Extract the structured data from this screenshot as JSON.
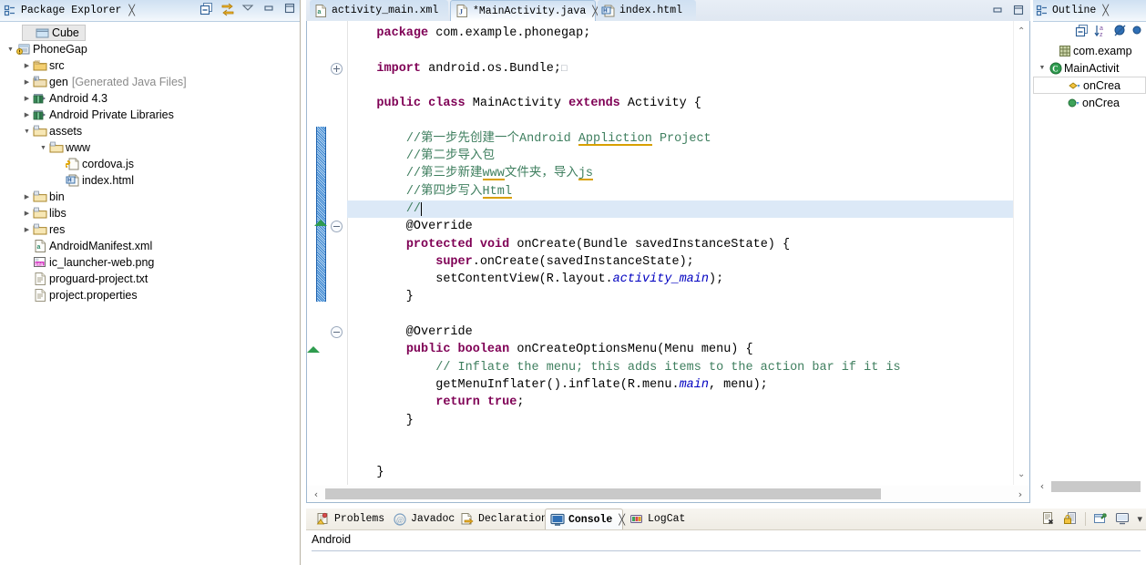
{
  "package_explorer": {
    "title": "Package Explorer",
    "close_glyph": "╳",
    "toolbar": [
      {
        "name": "collapse-all-icon",
        "title": "Collapse All"
      },
      {
        "name": "link-with-editor-icon",
        "title": "Link with Editor"
      },
      {
        "name": "view-menu-icon",
        "title": "View Menu"
      },
      {
        "name": "minimize-icon",
        "title": "Minimize"
      },
      {
        "name": "maximize-icon",
        "title": "Maximize"
      }
    ],
    "tree": [
      {
        "label": "Cube",
        "icon": "project-closed-icon",
        "twisty": "",
        "indent": 1,
        "selected": true,
        "note": ""
      },
      {
        "label": "PhoneGap",
        "icon": "android-project-icon",
        "twisty": "▼",
        "indent": 0,
        "selected": false,
        "note": ""
      },
      {
        "label": "src",
        "icon": "source-folder-icon",
        "twisty": "▶",
        "indent": 1,
        "selected": false,
        "note": ""
      },
      {
        "label": "gen",
        "icon": "gen-folder-icon",
        "twisty": "▶",
        "indent": 1,
        "selected": false,
        "note": "[Generated Java Files]"
      },
      {
        "label": "Android 4.3",
        "icon": "library-icon",
        "twisty": "▶",
        "indent": 1,
        "selected": false,
        "note": ""
      },
      {
        "label": "Android Private Libraries",
        "icon": "library-icon",
        "twisty": "▶",
        "indent": 1,
        "selected": false,
        "note": ""
      },
      {
        "label": "assets",
        "icon": "folder-icon",
        "twisty": "▼",
        "indent": 1,
        "selected": false,
        "note": ""
      },
      {
        "label": "www",
        "icon": "folder-icon",
        "twisty": "▼",
        "indent": 2,
        "selected": false,
        "note": ""
      },
      {
        "label": "cordova.js",
        "icon": "js-file-icon",
        "twisty": "",
        "indent": 3,
        "selected": false,
        "note": ""
      },
      {
        "label": "index.html",
        "icon": "html-file-icon",
        "twisty": "",
        "indent": 3,
        "selected": false,
        "note": ""
      },
      {
        "label": "bin",
        "icon": "folder-icon",
        "twisty": "▶",
        "indent": 1,
        "selected": false,
        "note": ""
      },
      {
        "label": "libs",
        "icon": "folder-icon",
        "twisty": "▶",
        "indent": 1,
        "selected": false,
        "note": ""
      },
      {
        "label": "res",
        "icon": "folder-icon",
        "twisty": "▶",
        "indent": 1,
        "selected": false,
        "note": ""
      },
      {
        "label": "AndroidManifest.xml",
        "icon": "xml-file-icon",
        "twisty": "",
        "indent": 1,
        "selected": false,
        "note": ""
      },
      {
        "label": "ic_launcher-web.png",
        "icon": "png-file-icon",
        "twisty": "",
        "indent": 1,
        "selected": false,
        "note": ""
      },
      {
        "label": "proguard-project.txt",
        "icon": "text-file-icon",
        "twisty": "",
        "indent": 1,
        "selected": false,
        "note": ""
      },
      {
        "label": "project.properties",
        "icon": "text-file-icon",
        "twisty": "",
        "indent": 1,
        "selected": false,
        "note": ""
      }
    ]
  },
  "editor": {
    "tabs": [
      {
        "label": "activity_main.xml",
        "icon": "xml-file-icon",
        "active": false,
        "dirty": false,
        "closeable": false
      },
      {
        "label": "*MainActivity.java",
        "icon": "java-file-icon",
        "active": true,
        "dirty": true,
        "closeable": true
      },
      {
        "label": "index.html",
        "icon": "html-file-icon",
        "active": false,
        "dirty": false,
        "closeable": false
      }
    ],
    "close_glyph": "╳",
    "window_buttons": [
      {
        "name": "minimize-icon",
        "title": "Minimize"
      },
      {
        "name": "maximize-icon",
        "title": "Maximize"
      }
    ],
    "scroll": {
      "left_arrow": "‹",
      "right_arrow": "›",
      "up_caret": "⌃",
      "down_caret": "⌄"
    },
    "code_lines": [
      {
        "indent": 1,
        "tokens": [
          {
            "t": "package",
            "c": "kw"
          },
          {
            "t": " com.example.phonegap;",
            "c": ""
          }
        ]
      },
      {
        "indent": 0,
        "tokens": []
      },
      {
        "indent": 1,
        "fold": "plus",
        "tokens": [
          {
            "t": "import",
            "c": "kw"
          },
          {
            "t": " android.os.Bundle;",
            "c": ""
          },
          {
            "t": "□",
            "c": "box"
          }
        ]
      },
      {
        "indent": 0,
        "tokens": []
      },
      {
        "indent": 1,
        "tokens": [
          {
            "t": "public",
            "c": "kw"
          },
          {
            "t": " ",
            "c": ""
          },
          {
            "t": "class",
            "c": "kw"
          },
          {
            "t": " MainActivity ",
            "c": ""
          },
          {
            "t": "extends",
            "c": "kw"
          },
          {
            "t": " Activity {",
            "c": ""
          }
        ]
      },
      {
        "indent": 0,
        "tokens": []
      },
      {
        "indent": 2,
        "tokens": [
          {
            "t": "//第一步先创建一个Android ",
            "c": "cmt"
          },
          {
            "t": "Appliction",
            "c": "cmt-squig"
          },
          {
            "t": " Project",
            "c": "cmt"
          }
        ]
      },
      {
        "indent": 2,
        "tokens": [
          {
            "t": "//第二步导入包",
            "c": "cmt"
          }
        ]
      },
      {
        "indent": 2,
        "tokens": [
          {
            "t": "//第三步新建",
            "c": "cmt"
          },
          {
            "t": "www",
            "c": "cmt-squig"
          },
          {
            "t": "文件夹，导入",
            "c": "cmt"
          },
          {
            "t": "js",
            "c": "cmt-squig"
          }
        ]
      },
      {
        "indent": 2,
        "tokens": [
          {
            "t": "//第四步写入",
            "c": "cmt"
          },
          {
            "t": "Html",
            "c": "cmt-squig"
          }
        ]
      },
      {
        "indent": 2,
        "current": true,
        "caret": true,
        "tokens": [
          {
            "t": "//",
            "c": "cmt"
          }
        ]
      },
      {
        "indent": 2,
        "fold": "minus",
        "tokens": [
          {
            "t": "@Override",
            "c": ""
          }
        ]
      },
      {
        "indent": 2,
        "tokens": [
          {
            "t": "protected",
            "c": "kw"
          },
          {
            "t": " ",
            "c": ""
          },
          {
            "t": "void",
            "c": "kw"
          },
          {
            "t": " onCreate(Bundle savedInstanceState) {",
            "c": ""
          }
        ]
      },
      {
        "indent": 3,
        "tokens": [
          {
            "t": "super",
            "c": "kw"
          },
          {
            "t": ".onCreate(savedInstanceState);",
            "c": ""
          }
        ]
      },
      {
        "indent": 3,
        "tokens": [
          {
            "t": "setContentView(R.layout.",
            "c": ""
          },
          {
            "t": "activity_main",
            "c": "fld"
          },
          {
            "t": ");",
            "c": ""
          }
        ]
      },
      {
        "indent": 2,
        "tokens": [
          {
            "t": "}",
            "c": ""
          }
        ]
      },
      {
        "indent": 0,
        "tokens": []
      },
      {
        "indent": 2,
        "fold": "minus",
        "tokens": [
          {
            "t": "@Override",
            "c": ""
          }
        ]
      },
      {
        "indent": 2,
        "marker": "arrow-up",
        "tokens": [
          {
            "t": "public",
            "c": "kw"
          },
          {
            "t": " ",
            "c": ""
          },
          {
            "t": "boolean",
            "c": "kw"
          },
          {
            "t": " onCreateOptionsMenu(Menu menu) {",
            "c": ""
          }
        ]
      },
      {
        "indent": 3,
        "tokens": [
          {
            "t": "// Inflate the menu; this adds items to the action bar if it is",
            "c": "cmt"
          }
        ]
      },
      {
        "indent": 3,
        "tokens": [
          {
            "t": "getMenuInflater().inflate(R.menu.",
            "c": ""
          },
          {
            "t": "main",
            "c": "fld"
          },
          {
            "t": ", menu);",
            "c": ""
          }
        ]
      },
      {
        "indent": 3,
        "tokens": [
          {
            "t": "return",
            "c": "kw"
          },
          {
            "t": " ",
            "c": ""
          },
          {
            "t": "true",
            "c": "kw"
          },
          {
            "t": ";",
            "c": ""
          }
        ]
      },
      {
        "indent": 2,
        "tokens": [
          {
            "t": "}",
            "c": ""
          }
        ]
      },
      {
        "indent": 0,
        "tokens": []
      },
      {
        "indent": 0,
        "tokens": []
      },
      {
        "indent": 1,
        "tokens": [
          {
            "t": "}",
            "c": ""
          }
        ]
      }
    ]
  },
  "outline": {
    "title": "Outline",
    "close_glyph": "╳",
    "toolbar": [
      {
        "name": "collapse-all-icon",
        "title": "Collapse All"
      },
      {
        "name": "sort-alphabetically-icon",
        "title": "Sort"
      },
      {
        "name": "hide-fields-icon",
        "title": "Hide Fields"
      },
      {
        "name": "hide-static-icon",
        "title": "Hide Static Members"
      }
    ],
    "items": [
      {
        "label": "com.examp",
        "icon": "package-icon",
        "twisty": "",
        "indent": 1,
        "boxed": false
      },
      {
        "label": "MainActivit",
        "icon": "class-icon",
        "twisty": "▼",
        "indent": 0,
        "boxed": false
      },
      {
        "label": "onCrea",
        "icon": "method-protected-icon",
        "twisty": "",
        "indent": 2,
        "boxed": true
      },
      {
        "label": "onCrea",
        "icon": "method-public-icon",
        "twisty": "",
        "indent": 2,
        "boxed": false
      }
    ],
    "scroll": {
      "left_arrow": "‹"
    }
  },
  "bottom": {
    "tabs": [
      {
        "label": "Problems",
        "icon": "problems-icon",
        "active": false,
        "closeable": false
      },
      {
        "label": "Javadoc",
        "icon": "javadoc-icon",
        "active": false,
        "closeable": false
      },
      {
        "label": "Declaration",
        "icon": "declaration-icon",
        "active": false,
        "closeable": false
      },
      {
        "label": "Console",
        "icon": "console-icon",
        "active": true,
        "closeable": true
      },
      {
        "label": "LogCat",
        "icon": "logcat-icon",
        "active": false,
        "closeable": false
      }
    ],
    "close_glyph": "╳",
    "toolbar": [
      {
        "name": "clear-console-icon",
        "title": "Clear Console"
      },
      {
        "name": "scroll-lock-icon",
        "title": "Scroll Lock"
      },
      {
        "name": "pin-console-icon",
        "title": "Pin Console"
      },
      {
        "name": "display-selected-console-icon",
        "title": "Display Selected Console"
      },
      {
        "name": "open-console-menu-icon",
        "title": "Open Console"
      }
    ],
    "menu_arrow": "▾",
    "console_output": "Android"
  },
  "colors": {
    "keyword": "#7F0055",
    "comment": "#3F7F5F",
    "field": "#0000C0",
    "tab_active": "#CFE0F2",
    "change_bar": "#2F7FD0",
    "selection": "#DCE9F7"
  }
}
